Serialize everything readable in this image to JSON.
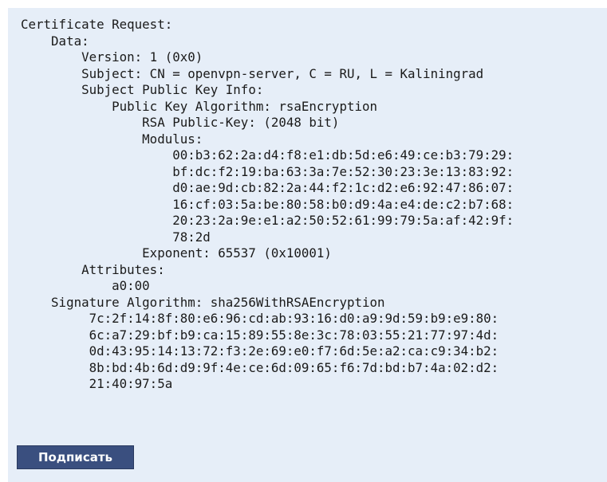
{
  "certificate": {
    "lines": [
      "Certificate Request:",
      "    Data:",
      "        Version: 1 (0x0)",
      "        Subject: CN = openvpn-server, C = RU, L = Kaliningrad",
      "        Subject Public Key Info:",
      "            Public Key Algorithm: rsaEncryption",
      "                RSA Public-Key: (2048 bit)",
      "                Modulus:",
      "                    00:b3:62:2a:d4:f8:e1:db:5d:e6:49:ce:b3:79:29:",
      "                    bf:dc:f2:19:ba:63:3a:7e:52:30:23:3e:13:83:92:",
      "                    d0:ae:9d:cb:82:2a:44:f2:1c:d2:e6:92:47:86:07:",
      "                    16:cf:03:5a:be:80:58:b0:d9:4a:e4:de:c2:b7:68:",
      "                    20:23:2a:9e:e1:a2:50:52:61:99:79:5a:af:42:9f:",
      "                    78:2d",
      "                Exponent: 65537 (0x10001)",
      "        Attributes:",
      "            a0:00",
      "    Signature Algorithm: sha256WithRSAEncryption",
      "         7c:2f:14:8f:80:e6:96:cd:ab:93:16:d0:a9:9d:59:b9:e9:80:",
      "         6c:a7:29:bf:b9:ca:15:89:55:8e:3c:78:03:55:21:77:97:4d:",
      "         0d:43:95:14:13:72:f3:2e:69:e0:f7:6d:5e:a2:ca:c9:34:b2:",
      "         8b:bd:4b:6d:d9:9f:4e:ce:6d:09:65:f6:7d:bd:b7:4a:02:d2:",
      "         21:40:97:5a"
    ]
  },
  "actions": {
    "sign_label": "Подписать"
  },
  "colors": {
    "panel_background": "#e6eef8",
    "button_background": "#3a4f7f",
    "text": "#1a1a1a"
  }
}
